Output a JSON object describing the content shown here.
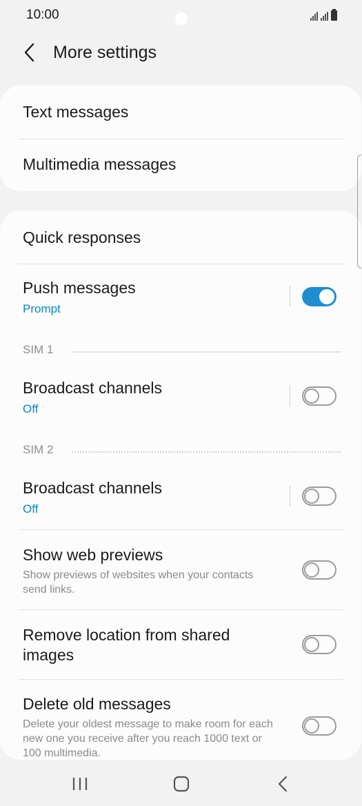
{
  "status": {
    "time": "10:00"
  },
  "header": {
    "title": "More settings",
    "back_icon": "chevron-left-icon"
  },
  "group1": {
    "items": [
      {
        "title": "Text messages"
      },
      {
        "title": "Multimedia messages"
      }
    ]
  },
  "group2": {
    "quick_responses": {
      "title": "Quick responses"
    },
    "push_messages": {
      "title": "Push messages",
      "sub": "Prompt",
      "enabled": true
    },
    "sim1": {
      "label": "SIM 1",
      "broadcast": {
        "title": "Broadcast channels",
        "sub": "Off",
        "enabled": false
      }
    },
    "sim2": {
      "label": "SIM 2",
      "broadcast": {
        "title": "Broadcast channels",
        "sub": "Off",
        "enabled": false
      }
    },
    "web_previews": {
      "title": "Show web previews",
      "desc": "Show previews of websites when your contacts send links.",
      "enabled": false
    },
    "remove_location": {
      "title": "Remove location from shared images",
      "enabled": false
    },
    "delete_old": {
      "title": "Delete old messages",
      "desc": "Delete your oldest message to make room for each new one you receive after you reach 1000 text or 100 multimedia.",
      "enabled": false
    }
  },
  "colors": {
    "accent": "#1f8ed0",
    "subtitle": "#0a84c4",
    "background": "#f2f2f2",
    "card": "#fcfcfc"
  },
  "nav": {
    "recents_icon": "recents-icon",
    "home_icon": "home-icon",
    "back_icon": "back-icon"
  }
}
